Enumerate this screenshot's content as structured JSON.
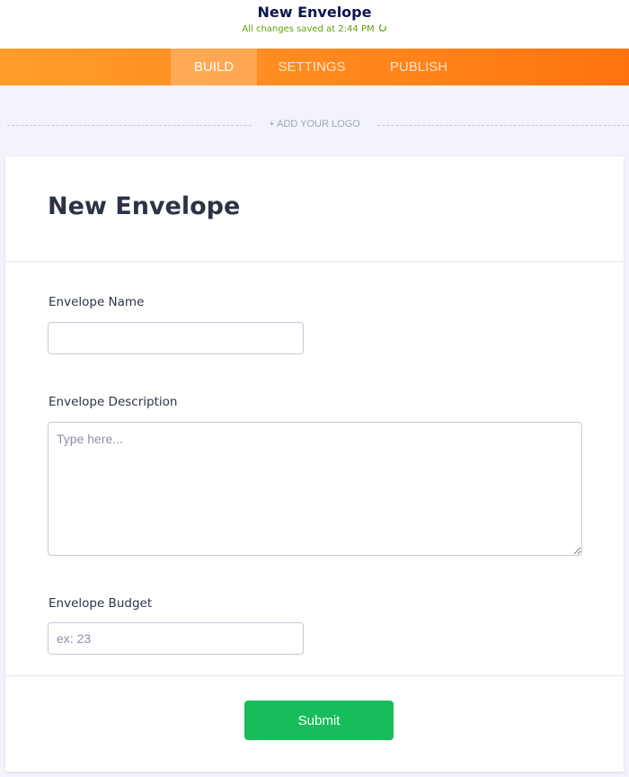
{
  "header": {
    "title": "New Envelope",
    "save_status": "All changes saved at 2:44 PM",
    "save_icon": "refresh-icon",
    "status_color": "#5fa00b"
  },
  "nav": {
    "tabs": [
      {
        "label": "BUILD",
        "active": true
      },
      {
        "label": "SETTINGS",
        "active": false
      },
      {
        "label": "PUBLISH",
        "active": false
      }
    ],
    "accent_color": "#ff8a1f"
  },
  "logo": {
    "label": "+ ADD YOUR LOGO"
  },
  "form": {
    "title": "New Envelope",
    "fields": {
      "name": {
        "label": "Envelope Name",
        "value": "",
        "placeholder": ""
      },
      "description": {
        "label": "Envelope Description",
        "value": "",
        "placeholder": "Type here..."
      },
      "budget": {
        "label": "Envelope Budget",
        "value": "",
        "placeholder": "ex: 23"
      }
    },
    "submit_label": "Submit",
    "submit_color": "#18bd5b"
  }
}
